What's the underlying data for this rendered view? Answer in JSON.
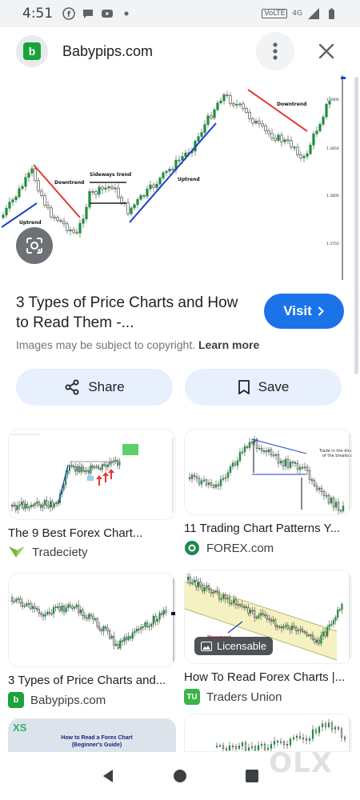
{
  "status_bar": {
    "time": "4:51",
    "network": "VoLTE",
    "signal_label": "4G"
  },
  "header": {
    "site_icon_letter": "b",
    "site_name": "Babypips.com"
  },
  "main_image": {
    "labels": {
      "uptrend_left": "Uptrend",
      "downtrend_left": "Downtrend",
      "sideways": "Sideways trend",
      "uptrend_mid": "Uptrend",
      "downtrend_right": "Downtrend"
    },
    "price_ticks": [
      "1.3900",
      "1.3850",
      "1.3800",
      "1.3750"
    ]
  },
  "result": {
    "title": "3 Types of Price Charts and How to Read Them -...",
    "visit_label": "Visit",
    "copyright_text": "Images may be subject to copyright.",
    "learn_more": "Learn more",
    "share_label": "Share",
    "save_label": "Save"
  },
  "related": [
    {
      "title": "The 9 Best Forex Chart...",
      "source": "Tradeciety",
      "icon_color": "#7cb342"
    },
    {
      "title": "11 Trading Chart Patterns Y...",
      "source": "FOREX.com",
      "icon_color": "#1b8a4a"
    },
    {
      "title": "3 Types of Price Charts and...",
      "source": "Babypips.com",
      "icon_color": "#1aa33a",
      "icon_letter": "b"
    },
    {
      "title": "How To Read Forex Charts |...",
      "source": "Traders Union",
      "icon_color": "#3bb44a",
      "icon_letter": "TU",
      "badge": "Licensable"
    },
    {
      "thumb_text": "How to Read a Forex Chart (Beginner's Guide)",
      "logo_text": "XS"
    }
  ],
  "watermark": "OLX",
  "colors": {
    "accent": "#1a73e8",
    "button_bg": "#e8f0fe",
    "bull": "#1e8e3e",
    "bear": "#333333",
    "trend_red": "#e53935",
    "trend_blue": "#1e40c8"
  }
}
